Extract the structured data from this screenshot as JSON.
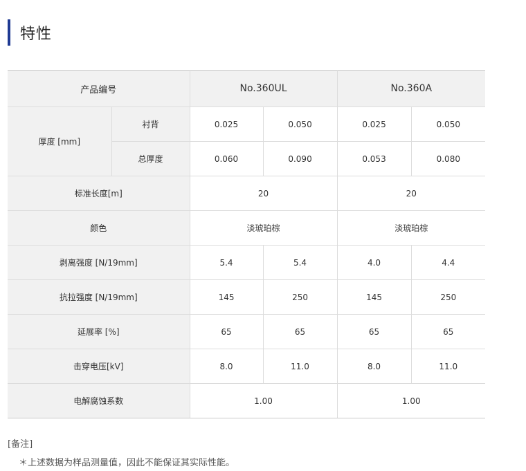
{
  "section_title": "特性",
  "table": {
    "header": {
      "label": "产品编号",
      "col_a": "No.360UL",
      "col_b": "No.360A"
    },
    "thickness": {
      "label": "厚度 [mm]",
      "backing": {
        "label": "衬背",
        "values": [
          "0.025",
          "0.050",
          "0.025",
          "0.050"
        ]
      },
      "total": {
        "label": "总厚度",
        "values": [
          "0.060",
          "0.090",
          "0.053",
          "0.080"
        ]
      }
    },
    "length": {
      "label": "标准长度[m]",
      "values": [
        "20",
        "20"
      ]
    },
    "color": {
      "label": "颜色",
      "values": [
        "淡琥珀棕",
        "淡琥珀棕"
      ]
    },
    "peel": {
      "label": "剥离强度 [N/19mm]",
      "values": [
        "5.4",
        "5.4",
        "4.0",
        "4.4"
      ]
    },
    "tensile": {
      "label": "抗拉强度 [N/19mm]",
      "values": [
        "145",
        "250",
        "145",
        "250"
      ]
    },
    "elongation": {
      "label": "延展率 [%]",
      "values": [
        "65",
        "65",
        "65",
        "65"
      ]
    },
    "breakdown": {
      "label": "击穿电压[kV]",
      "values": [
        "8.0",
        "11.0",
        "8.0",
        "11.0"
      ]
    },
    "corrosion": {
      "label": "电解腐蚀系数",
      "values": [
        "1.00",
        "1.00"
      ]
    }
  },
  "notes": {
    "title": "[备注]",
    "line": "＊上述数据为样品测量值，因此不能保证其实际性能。"
  }
}
